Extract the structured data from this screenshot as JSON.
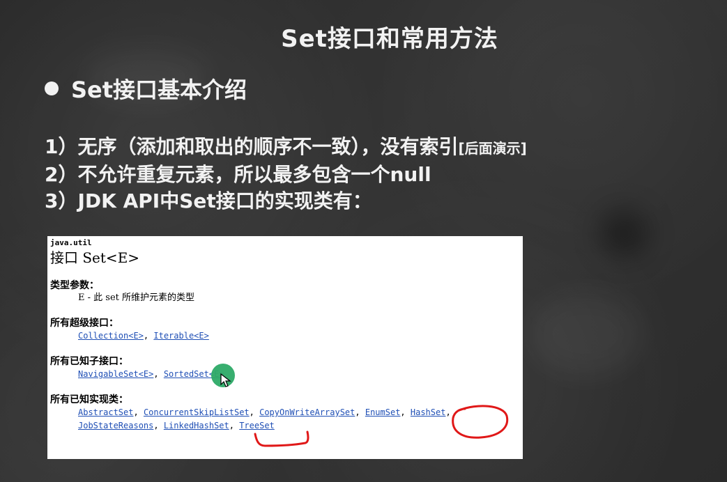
{
  "slide": {
    "title": "Set接口和常用方法",
    "bullet": "Set接口基本介绍",
    "points": [
      {
        "main": "1）无序（添加和取出的顺序不一致），没有索引",
        "note": "[后面演示]"
      },
      {
        "main": "2）不允许重复元素，所以最多包含一个null",
        "note": ""
      },
      {
        "main": "3）JDK API中Set接口的实现类有：",
        "note": ""
      }
    ]
  },
  "doc": {
    "package": "java.util",
    "heading": "接口 Set<E>",
    "sections": {
      "type_params": {
        "label": "类型参数：",
        "text": "E - 此 set 所维护元素的类型"
      },
      "super_interfaces": {
        "label": "所有超级接口：",
        "items": [
          "Collection<E>",
          "Iterable<E>"
        ]
      },
      "sub_interfaces": {
        "label": "所有已知子接口：",
        "items": [
          "NavigableSet<E>",
          "SortedSet<E>"
        ]
      },
      "implementations": {
        "label": "所有已知实现类：",
        "row1": [
          "AbstractSet",
          "ConcurrentSkipListSet",
          "CopyOnWriteArraySet",
          "EnumSet",
          "HashSet"
        ],
        "row2": [
          "JobStateReasons",
          "LinkedHashSet",
          "TreeSet"
        ]
      }
    }
  },
  "annotations": {
    "circle_color": "#e01818",
    "underline_color": "#e01818",
    "cursor_color": "#2daa67"
  }
}
